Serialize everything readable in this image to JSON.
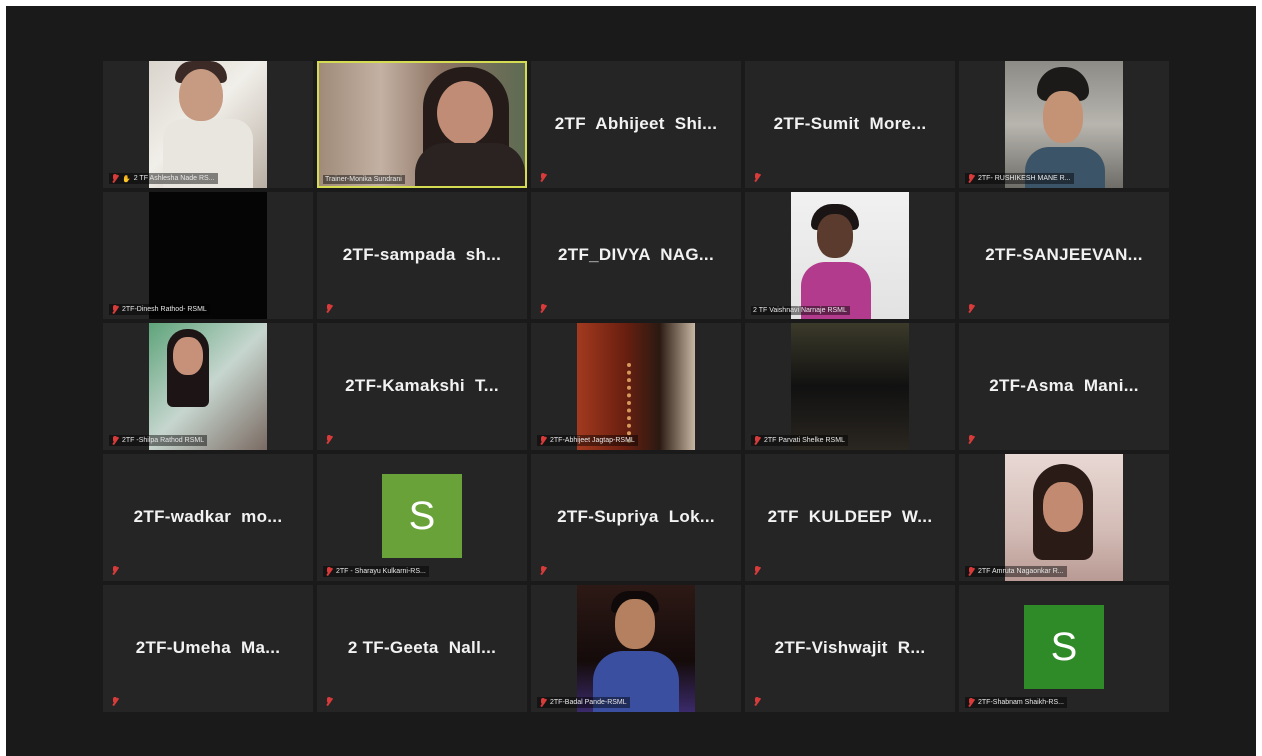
{
  "meeting": {
    "participants": [
      {
        "type": "video",
        "photo": "ph-1",
        "label": "2 TF Ashlesha Nade RS...",
        "hand": "✋"
      },
      {
        "type": "video",
        "photo": "ph-2",
        "label": "Trainer-Monika Sundrani",
        "active": true,
        "wide": true
      },
      {
        "type": "name",
        "display": "2TF  Abhijeet  Shi..."
      },
      {
        "type": "name",
        "display": "2TF-Sumit  More..."
      },
      {
        "type": "video",
        "photo": "ph-3",
        "label": "2TF- RUSHIKESH MANE R..."
      },
      {
        "type": "video",
        "photo": "ph-4",
        "label": "2TF-Dinesh Rathod- RSML"
      },
      {
        "type": "name",
        "display": "2TF-sampada  sh..."
      },
      {
        "type": "name",
        "display": "2TF_DIVYA  NAG..."
      },
      {
        "type": "video",
        "photo": "ph-5",
        "label": "2 TF Vaishnavi Narnaje RSML"
      },
      {
        "type": "name",
        "display": "2TF-SANJEEVAN..."
      },
      {
        "type": "video",
        "photo": "ph-6",
        "label": "2TF -Shilpa Rathod RSML"
      },
      {
        "type": "name",
        "display": "2TF-Kamakshi  T..."
      },
      {
        "type": "video",
        "photo": "ph-7",
        "label": "2TF-Abhijeet Jagtap-RSML"
      },
      {
        "type": "video",
        "photo": "ph-8",
        "label": "2TF Parvati Shelke RSML"
      },
      {
        "type": "name",
        "display": "2TF-Asma  Mani..."
      },
      {
        "type": "name",
        "display": "2TF-wadkar  mo..."
      },
      {
        "type": "avatar",
        "letter": "S",
        "color": "#6aa23a",
        "label": "2TF - Sharayu Kulkarni-RS..."
      },
      {
        "type": "name",
        "display": "2TF-Supriya  Lok..."
      },
      {
        "type": "name",
        "display": "2TF  KULDEEP  W..."
      },
      {
        "type": "video",
        "photo": "ph-9",
        "label": "2TF Amruta Nagaonkar R..."
      },
      {
        "type": "name",
        "display": "2TF-Umeha  Ma..."
      },
      {
        "type": "name",
        "display": "2 TF-Geeta  Nall..."
      },
      {
        "type": "video",
        "photo": "ph-10",
        "label": "2TF-Badal Pande-RSML"
      },
      {
        "type": "name",
        "display": "2TF-Vishwajit  R..."
      },
      {
        "type": "avatar",
        "letter": "S",
        "color": "#2f8a28",
        "label": "2TF-Shabnam Shaikh-RS..."
      }
    ]
  }
}
